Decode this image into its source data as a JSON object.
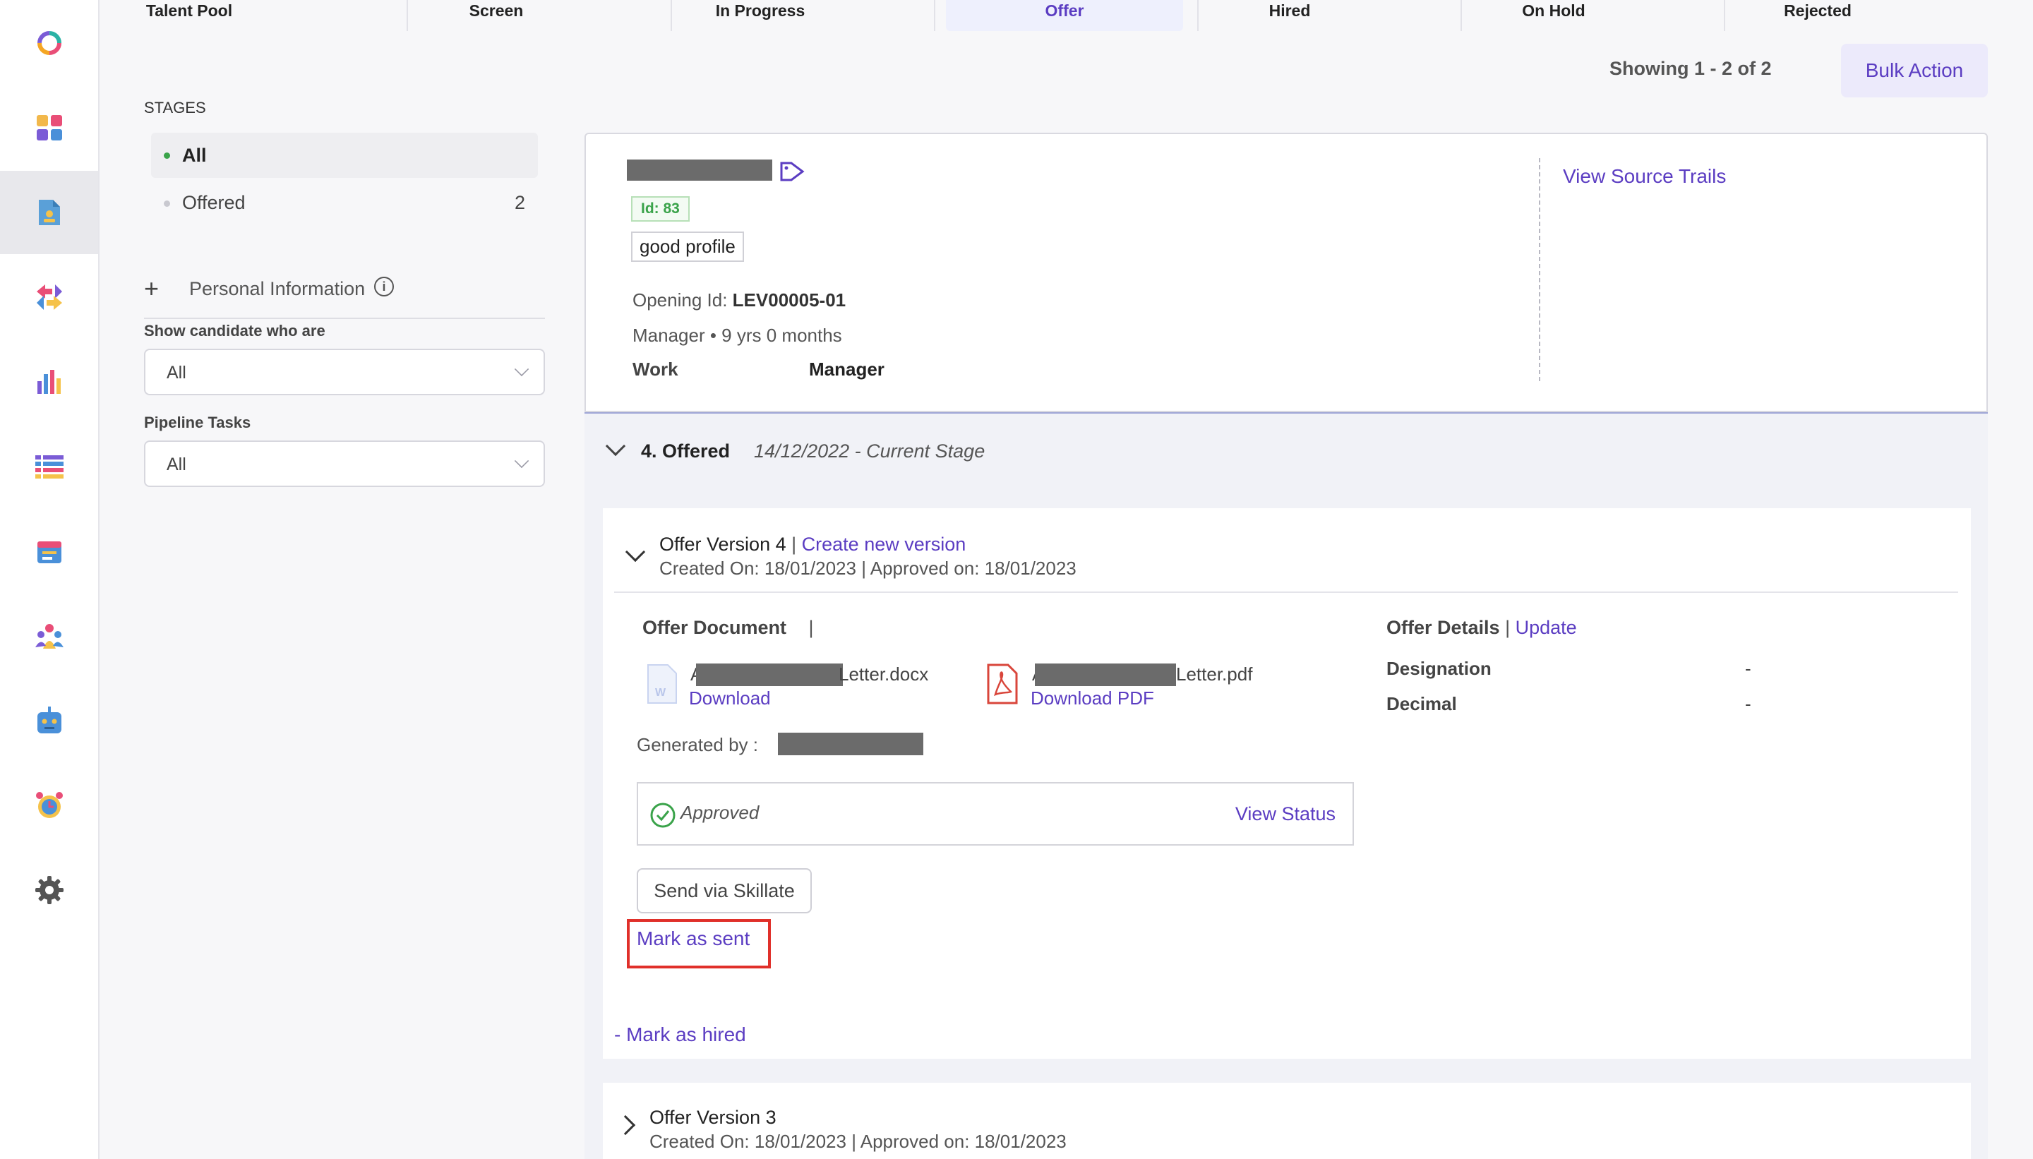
{
  "tabs": [
    {
      "label": "Talent Pool",
      "active": false
    },
    {
      "label": "Screen",
      "active": false
    },
    {
      "label": "In Progress",
      "active": false
    },
    {
      "label": "Offer",
      "active": true
    },
    {
      "label": "Hired",
      "active": false
    },
    {
      "label": "On Hold",
      "active": false
    },
    {
      "label": "Rejected",
      "active": false
    }
  ],
  "header": {
    "showing": "Showing 1 - 2 of 2",
    "bulk_action": "Bulk Action"
  },
  "sidebar": {
    "stages_title": "STAGES",
    "stages": [
      {
        "label": "All",
        "count": ""
      },
      {
        "label": "Offered",
        "count": "2"
      }
    ],
    "personal_info": "Personal Information",
    "show_candidate_label": "Show candidate who are",
    "show_candidate_value": "All",
    "pipeline_tasks_label": "Pipeline Tasks",
    "pipeline_tasks_value": "All"
  },
  "candidate": {
    "id_badge": "Id: 83",
    "tag": "good profile",
    "opening_label": "Opening Id:",
    "opening_value": "LEV00005-01",
    "experience": "Manager • 9 yrs 0 months",
    "work_label": "Work",
    "work_value": "Manager",
    "view_source_trails": "View Source Trails"
  },
  "stage": {
    "title": "4. Offered",
    "meta": "14/12/2022 - Current Stage"
  },
  "offer_v4": {
    "title": "Offer Version 4",
    "separator": "|",
    "create_new": "Create new version",
    "created": "Created On: 18/01/2023 | Approved on: 18/01/2023",
    "doc_heading": "Offer Document",
    "doc_sep": "|",
    "docx_name": "Letter.docx",
    "docx_prefix": "A",
    "docx_download": "Download",
    "pdf_name": "Letter.pdf",
    "pdf_prefix": "A",
    "pdf_download": "Download PDF",
    "generated_by": "Generated by :",
    "status_text": "Approved",
    "view_status": "View Status",
    "send_btn": "Send via Skillate",
    "mark_sent": "Mark as sent",
    "details_heading": "Offer Details",
    "details_sep": "|",
    "update": "Update",
    "details": [
      {
        "label": "Designation",
        "value": "-"
      },
      {
        "label": "Decimal",
        "value": "-"
      }
    ]
  },
  "mark_hired": "- Mark as hired",
  "offer_v3": {
    "title": "Offer Version 3",
    "created": "Created On: 18/01/2023 | Approved on: 18/01/2023"
  },
  "colors": {
    "accent": "#5b3dc2",
    "approved_green": "#3aa34a",
    "highlight_red": "#e0302a",
    "pdf_red": "#d9463b"
  }
}
